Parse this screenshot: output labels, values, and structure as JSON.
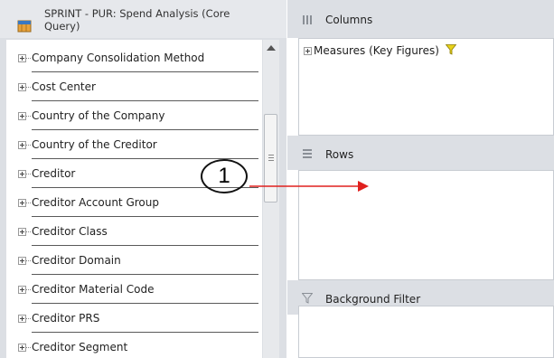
{
  "query_panel": {
    "title": "SPRINT - PUR: Spend Analysis (Core Query)",
    "icon": "cube-icon"
  },
  "dimensions": [
    {
      "label": "Company Consolidation Method"
    },
    {
      "label": "Cost Center"
    },
    {
      "label": "Country of the Company"
    },
    {
      "label": "Country of the Creditor"
    },
    {
      "label": "Creditor"
    },
    {
      "label": "Creditor Account Group"
    },
    {
      "label": "Creditor Class"
    },
    {
      "label": "Creditor Domain"
    },
    {
      "label": "Creditor Material Code"
    },
    {
      "label": "Creditor PRS"
    },
    {
      "label": "Creditor Segment"
    }
  ],
  "columns": {
    "title": "Columns",
    "items": [
      {
        "label": "Measures (Key Figures)",
        "has_filter": true
      }
    ]
  },
  "rows": {
    "title": "Rows"
  },
  "background_filter": {
    "title": "Background Filter"
  },
  "callout": {
    "number": "1",
    "color": "#e0201e"
  },
  "colors": {
    "panel_bg": "#dcdfe4",
    "filter_funnel": "#e8d21a",
    "arrow": "#e0201e"
  }
}
